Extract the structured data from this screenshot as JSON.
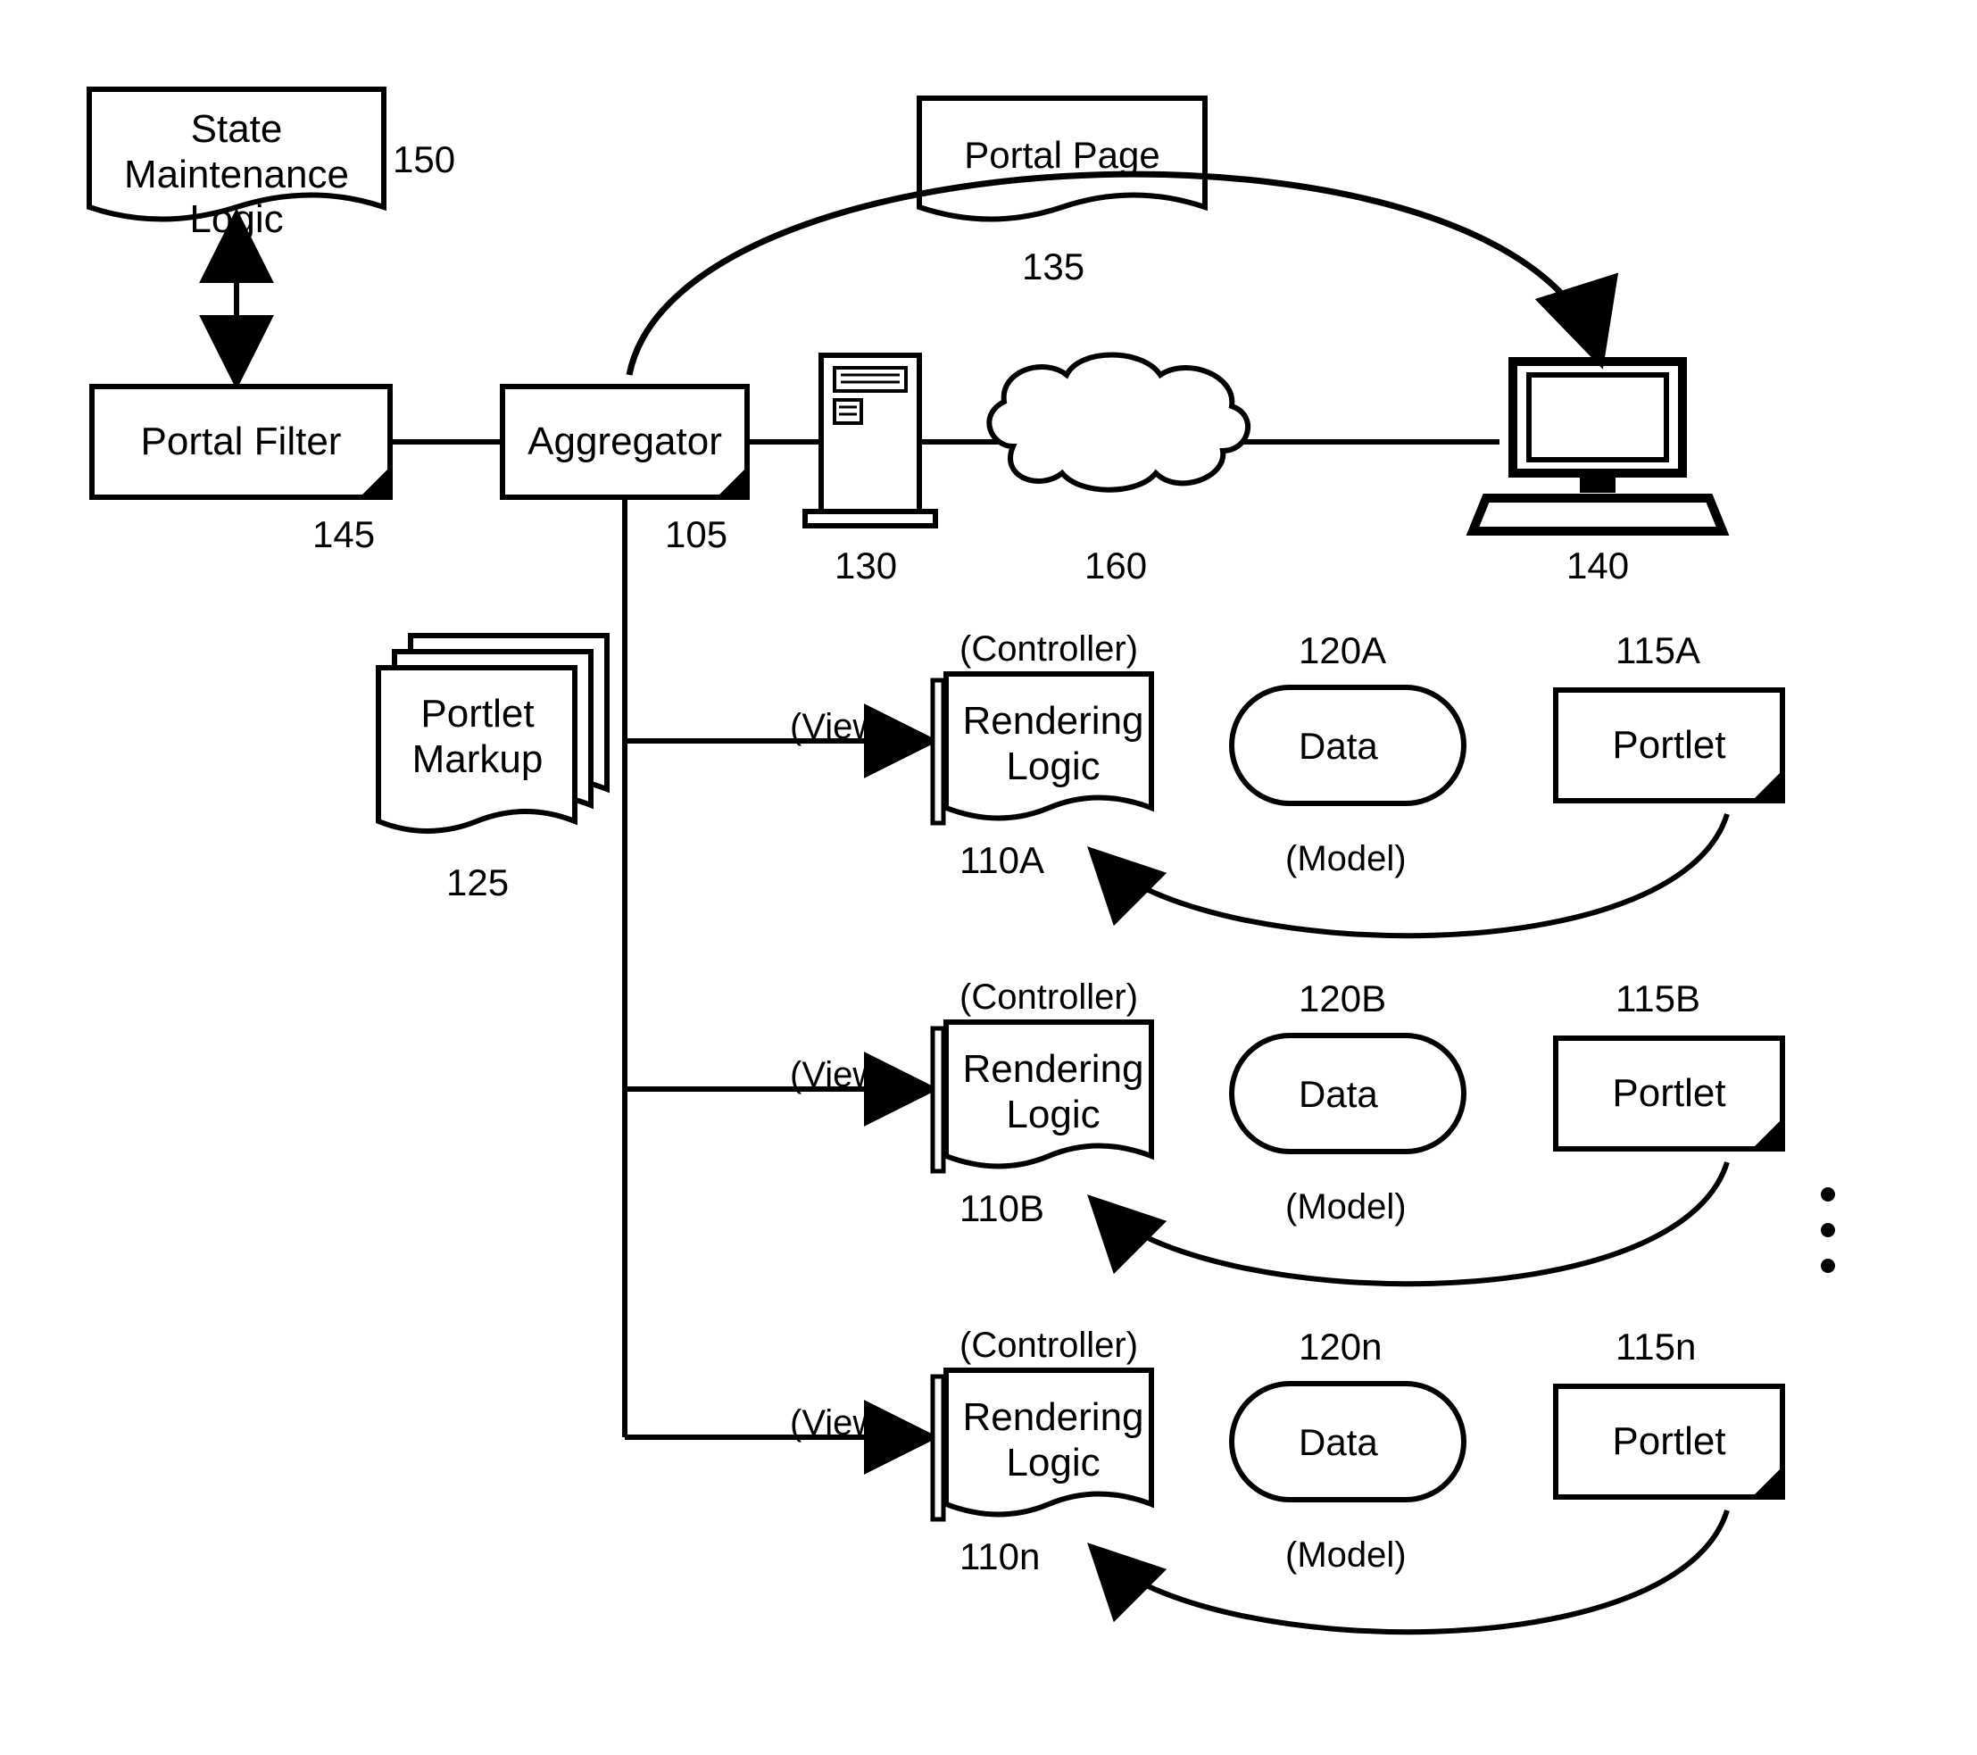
{
  "nodes": {
    "state_maintenance": {
      "line1": "State Maintenance",
      "line2": "Logic",
      "ref": "150"
    },
    "portal_filter": {
      "label": "Portal Filter",
      "ref": "145"
    },
    "aggregator": {
      "label": "Aggregator",
      "ref": "105"
    },
    "portal_page": {
      "label": "Portal Page",
      "ref": "135"
    },
    "server": {
      "ref": "130"
    },
    "cloud": {
      "ref": "160"
    },
    "client": {
      "ref": "140"
    },
    "portlet_markup": {
      "line1": "Portlet",
      "line2": "Markup",
      "ref": "125"
    }
  },
  "mvc_labels": {
    "view": "(View)",
    "controller": "(Controller)",
    "model": "(Model)"
  },
  "rows": [
    {
      "rendering": {
        "line1": "Rendering",
        "line2": "Logic",
        "ref": "110A"
      },
      "data": {
        "label": "Data",
        "ref": "120A"
      },
      "portlet": {
        "label": "Portlet",
        "ref": "115A"
      }
    },
    {
      "rendering": {
        "line1": "Rendering",
        "line2": "Logic",
        "ref": "110B"
      },
      "data": {
        "label": "Data",
        "ref": "120B"
      },
      "portlet": {
        "label": "Portlet",
        "ref": "115B"
      }
    },
    {
      "rendering": {
        "line1": "Rendering",
        "line2": "Logic",
        "ref": "110n"
      },
      "data": {
        "label": "Data",
        "ref": "120n"
      },
      "portlet": {
        "label": "Portlet",
        "ref": "115n"
      }
    }
  ]
}
